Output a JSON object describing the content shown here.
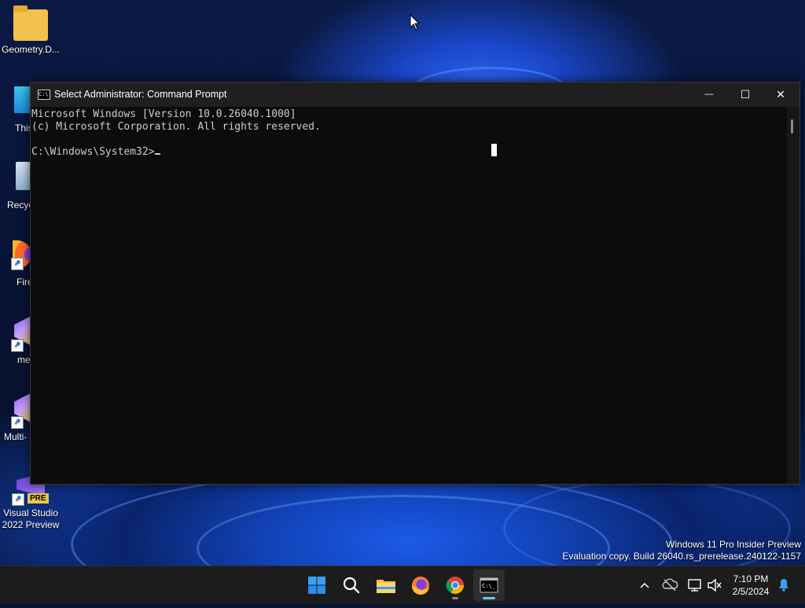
{
  "desktop": {
    "icons": [
      {
        "label": "Geometry.D..."
      },
      {
        "label": "This"
      },
      {
        "label": "Recyc"
      },
      {
        "label": "Fire"
      },
      {
        "label": "me"
      },
      {
        "label": "Multi-"
      },
      {
        "label": "Visual Studio 2022 Preview",
        "badge": "PRE"
      }
    ]
  },
  "window": {
    "title": "Select Administrator: Command Prompt",
    "minimize": "—",
    "maximize": "☐",
    "close": "✕"
  },
  "console": {
    "lines": [
      "Microsoft Windows [Version 10.0.26040.1000]",
      "(c) Microsoft Corporation. All rights reserved.",
      "",
      "C:\\Windows\\System32>"
    ]
  },
  "watermark": {
    "line1": "Windows 11 Pro Insider Preview",
    "line2": "Evaluation copy. Build 26040.rs_prerelease.240122-1157"
  },
  "taskbar": {
    "apps": [
      "start-icon",
      "search-icon",
      "file-explorer-icon",
      "firefox-icon",
      "chrome-icon",
      "command-prompt-icon"
    ],
    "tray": {
      "chevron": "^",
      "time": "7:10 PM",
      "date": "2/5/2024"
    }
  },
  "colors": {
    "console_bg": "#0c0c0c",
    "console_fg": "#cccccc",
    "titlebar": "#1f1f1f",
    "taskbar": "#1c1c1c",
    "accent": "#60cdff"
  }
}
